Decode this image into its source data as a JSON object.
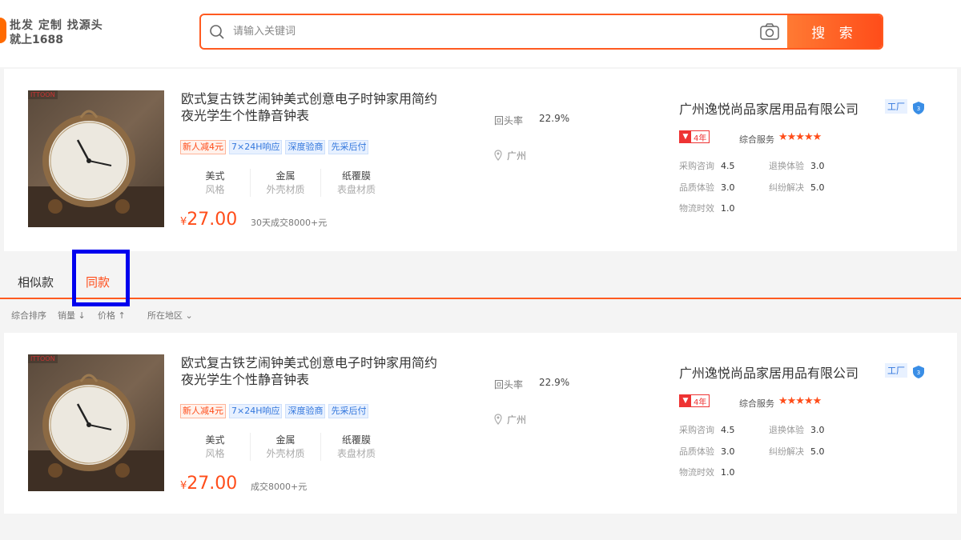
{
  "header": {
    "logo_line1": "批发 定制 找源头",
    "logo_line2": "就上1688",
    "search_placeholder": "请输入关键词",
    "search_button": "搜 索",
    "accent_color": "#ff5a20"
  },
  "products": [
    {
      "brand_mark": "ITTOON",
      "title": "欧式复古铁艺闹钟美式创意电子时钟家用简约夜光学生个性静音钟表",
      "tags": [
        {
          "text": "新人减4元",
          "style": "red"
        },
        {
          "text": "7×24H响应",
          "style": "blue"
        },
        {
          "text": "深度验商",
          "style": "blue"
        },
        {
          "text": "先采后付",
          "style": "blue"
        }
      ],
      "attrs": [
        {
          "value": "美式",
          "name": "风格"
        },
        {
          "value": "金属",
          "name": "外壳材质"
        },
        {
          "value": "纸覆膜",
          "name": "表盘材质"
        }
      ],
      "price_currency": "¥",
      "price": "27.00",
      "sales": "30天成交8000+元",
      "repeat_label": "回头率",
      "repeat_value": "22.9%",
      "location": "广州",
      "company": "广州逸悦尚品家居用品有限公司",
      "factory_badge": "工厂",
      "years": "4年",
      "service_label": "综合服务",
      "stars": "★★★★★",
      "scores": [
        {
          "label": "采购咨询",
          "value": "4.5"
        },
        {
          "label": "退换体验",
          "value": "3.0"
        },
        {
          "label": "品质体验",
          "value": "3.0"
        },
        {
          "label": "纠纷解决",
          "value": "5.0"
        },
        {
          "label": "物流时效",
          "value": "1.0"
        }
      ]
    },
    {
      "brand_mark": "ITTOON",
      "title": "欧式复古铁艺闹钟美式创意电子时钟家用简约夜光学生个性静音钟表",
      "tags": [
        {
          "text": "新人减4元",
          "style": "red"
        },
        {
          "text": "7×24H响应",
          "style": "blue"
        },
        {
          "text": "深度验商",
          "style": "blue"
        },
        {
          "text": "先采后付",
          "style": "blue"
        }
      ],
      "attrs": [
        {
          "value": "美式",
          "name": "风格"
        },
        {
          "value": "金属",
          "name": "外壳材质"
        },
        {
          "value": "纸覆膜",
          "name": "表盘材质"
        }
      ],
      "price_currency": "¥",
      "price": "27.00",
      "sales": "成交8000+元",
      "repeat_label": "回头率",
      "repeat_value": "22.9%",
      "location": "广州",
      "company": "广州逸悦尚品家居用品有限公司",
      "factory_badge": "工厂",
      "years": "4年",
      "service_label": "综合服务",
      "stars": "★★★★★",
      "scores": [
        {
          "label": "采购咨询",
          "value": "4.5"
        },
        {
          "label": "退换体验",
          "value": "3.0"
        },
        {
          "label": "品质体验",
          "value": "3.0"
        },
        {
          "label": "纠纷解决",
          "value": "5.0"
        },
        {
          "label": "物流时效",
          "value": "1.0"
        }
      ]
    }
  ],
  "tabs": {
    "similar": "相似款",
    "same": "同款",
    "active": "same"
  },
  "filters": {
    "sort_default": "综合排序",
    "sort_sales": "销量 ↓",
    "sort_price": "价格 ↑",
    "region": "所在地区 ⌄"
  }
}
